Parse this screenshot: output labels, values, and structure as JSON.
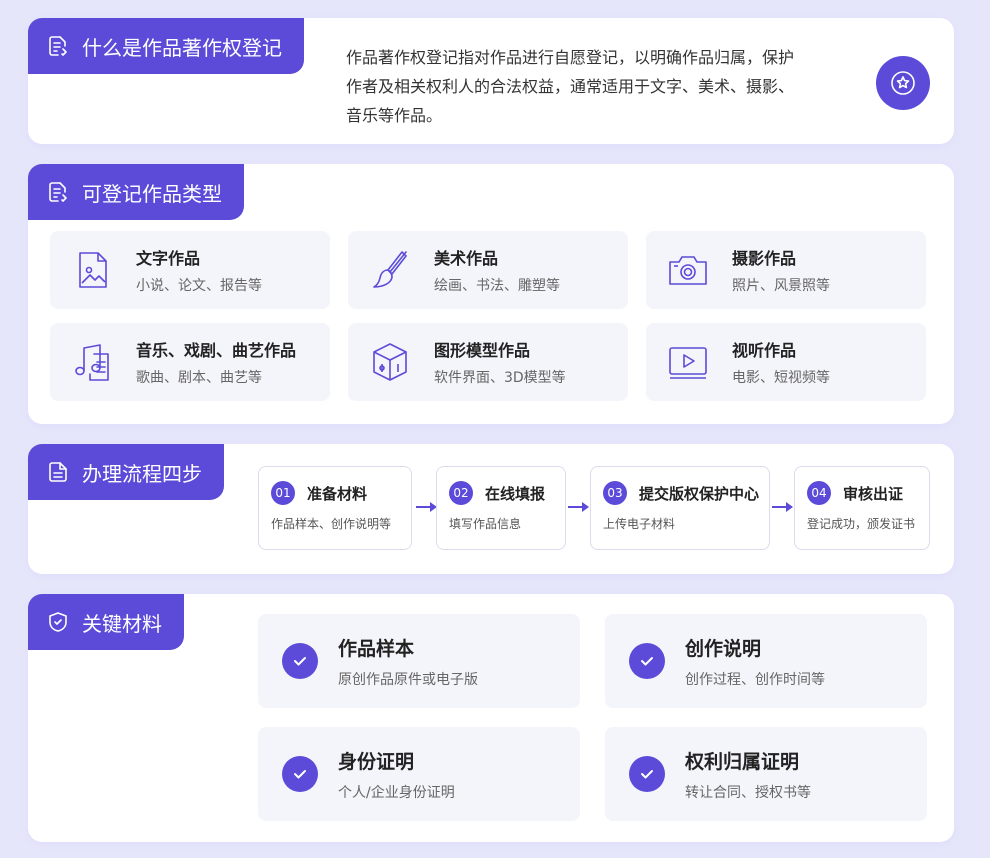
{
  "colors": {
    "accent": "#5b4bd8",
    "background": "#e6e6fb",
    "tile": "#f4f4fb"
  },
  "what": {
    "title": "什么是作品著作权登记",
    "icon": "document-edit-icon",
    "desc_line1": "作品著作权登记指对作品进行自愿登记，以明确作品归属，保护",
    "desc_line2": "作者及相关权利人的合法权益，通常适用于文字、美术、摄影、",
    "desc_line3": "音乐等作品。",
    "badge_icon": "star-badge-icon"
  },
  "types": {
    "title": "可登记作品类型",
    "icon": "document-edit-icon",
    "items": [
      {
        "title": "文字作品",
        "sub": "小说、论文、报告等",
        "icon": "image-file-icon"
      },
      {
        "title": "美术作品",
        "sub": "绘画、书法、雕塑等",
        "icon": "paintbrush-icon"
      },
      {
        "title": "摄影作品",
        "sub": "照片、风景照等",
        "icon": "camera-icon"
      },
      {
        "title": "音乐、戏剧、曲艺作品",
        "sub": "歌曲、剧本、曲艺等",
        "icon": "music-note-icon"
      },
      {
        "title": "图形模型作品",
        "sub": "软件界面、3D模型等",
        "icon": "3d-cube-icon"
      },
      {
        "title": "视听作品",
        "sub": "电影、短视频等",
        "icon": "video-play-icon"
      }
    ]
  },
  "process": {
    "title": "办理流程四步",
    "icon": "document-icon",
    "steps": [
      {
        "num": "01",
        "title": "准备材料",
        "sub": "作品样本、创作说明等"
      },
      {
        "num": "02",
        "title": "在线填报",
        "sub": "填写作品信息"
      },
      {
        "num": "03",
        "title": "提交版权保护中心",
        "sub": "上传电子材料"
      },
      {
        "num": "04",
        "title": "审核出证",
        "sub": "登记成功，颁发证书"
      }
    ]
  },
  "materials": {
    "title": "关键材料",
    "icon": "shield-check-icon",
    "items": [
      {
        "title": "作品样本",
        "sub": "原创作品原件或电子版"
      },
      {
        "title": "创作说明",
        "sub": "创作过程、创作时间等"
      },
      {
        "title": "身份证明",
        "sub": "个人/企业身份证明"
      },
      {
        "title": "权利归属证明",
        "sub": "转让合同、授权书等"
      }
    ]
  }
}
